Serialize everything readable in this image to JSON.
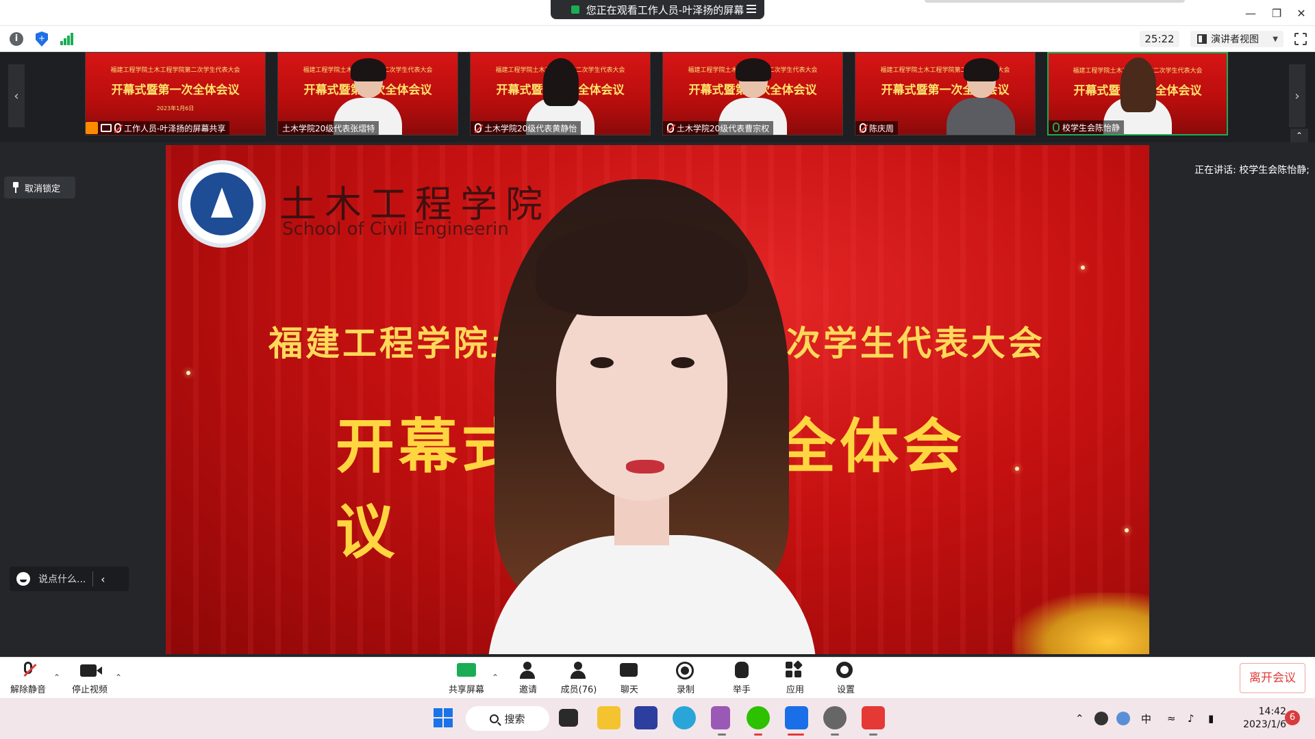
{
  "title_bar": {
    "sharing_banner": "您正在观看工作人员-叶泽扬的屏幕"
  },
  "status_bar": {
    "timer": "25:22",
    "view_mode": "演讲者视图"
  },
  "thumbnails": [
    {
      "label": "工作人员-叶泽扬的屏幕共享",
      "slide_title": "福建工程学院土木工程学院第二次学生代表大会",
      "slide_main": "开幕式暨第一次全体会议",
      "slide_date": "2023年1月6日",
      "mic": "off",
      "is_screen": true
    },
    {
      "label": "土木学院20级代表张熠特",
      "slide_title": "福建工程学院土木工程学院第二次学生代表大会",
      "slide_main": "开幕式暨第一次全体会议",
      "mic": "none",
      "is_screen": false
    },
    {
      "label": "土木学院20级代表黄静怡",
      "slide_title": "福建工程学院土木工程学院第二次学生代表大会",
      "slide_main": "开幕式暨第一次全体会议",
      "mic": "off",
      "is_screen": false
    },
    {
      "label": "土木学院20级代表曹宗权",
      "slide_title": "福建工程学院土木工程学院第二次学生代表大会",
      "slide_main": "开幕式暨第一次全体会议",
      "mic": "off",
      "is_screen": false
    },
    {
      "label": "陈庆周",
      "slide_title": "福建工程学院土木工程学院第二次学生代表大会",
      "slide_main": "开幕式暨第一次全体会议",
      "mic": "off",
      "is_screen": false
    },
    {
      "label": "校学生会陈怡静",
      "slide_title": "福建工程学院土木工程学院第二次学生代表大会",
      "slide_main": "开幕式暨第一次全体会议",
      "mic": "on",
      "is_screen": false
    }
  ],
  "stage": {
    "unlock_label": "取消锁定",
    "speaking_now": "正在讲话: 校学生会陈怡静;",
    "chat_placeholder": "说点什么...",
    "video": {
      "school_cn": "土木工程学院",
      "school_en": "School of Civil Engineerin",
      "banner_line1": "福建工程学院土木工程学院第二次学生代表大会",
      "banner_line2": "开幕式暨第一次全体会议"
    }
  },
  "toolbar": {
    "unmute": "解除静音",
    "stop_video": "停止视频",
    "share_screen": "共享屏幕",
    "invite": "邀请",
    "participants": "成员(76)",
    "chat": "聊天",
    "record": "录制",
    "raise_hand": "举手",
    "apps": "应用",
    "settings": "设置",
    "leave": "离开会议"
  },
  "taskbar": {
    "search_label": "搜索",
    "ime": "中",
    "time": "14:42",
    "date": "2023/1/6",
    "notification_count": "6"
  }
}
